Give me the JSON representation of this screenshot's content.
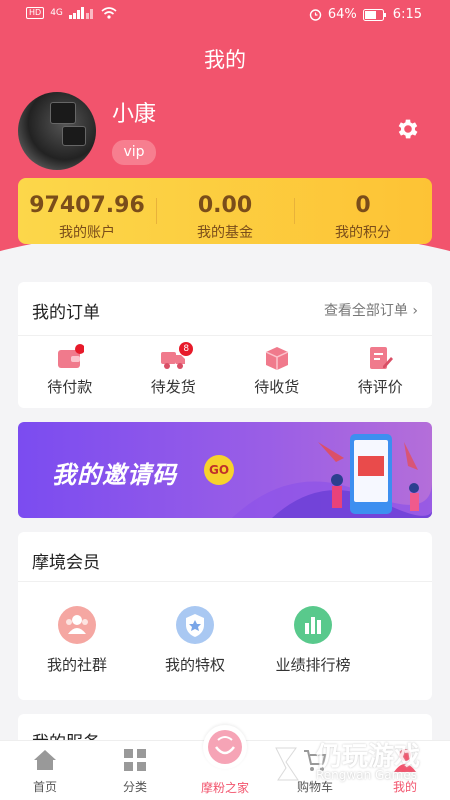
{
  "status": {
    "hd": "HD",
    "signal": "4G",
    "battery": "64%",
    "time": "6:15"
  },
  "title": "我的",
  "profile": {
    "name": "小康",
    "level": "vip"
  },
  "stats": [
    {
      "value": "97407.96",
      "label": "我的账户"
    },
    {
      "value": "0.00",
      "label": "我的基金"
    },
    {
      "value": "0",
      "label": "我的积分"
    }
  ],
  "orders": {
    "title": "我的订单",
    "more": "查看全部订单",
    "items": [
      {
        "label": "待付款",
        "badge": ""
      },
      {
        "label": "待发货",
        "badge": "8"
      },
      {
        "label": "待收货",
        "badge": ""
      },
      {
        "label": "待评价",
        "badge": ""
      }
    ]
  },
  "banner": {
    "text": "我的邀请码",
    "go": "GO"
  },
  "member": {
    "title": "摩境会员",
    "items": [
      {
        "label": "我的社群"
      },
      {
        "label": "我的特权"
      },
      {
        "label": "业绩排行榜"
      }
    ]
  },
  "service": {
    "title": "我的服务"
  },
  "tabs": [
    {
      "label": "首页"
    },
    {
      "label": "分类"
    },
    {
      "label": "摩粉之家"
    },
    {
      "label": "购物车"
    },
    {
      "label": "我的"
    }
  ],
  "watermark": {
    "cn": "仍玩游戏",
    "en": "Rengwan Games"
  },
  "colors": {
    "accent": "#f2546d",
    "gold": "#fdc335",
    "banner": "#7b4cf0"
  }
}
